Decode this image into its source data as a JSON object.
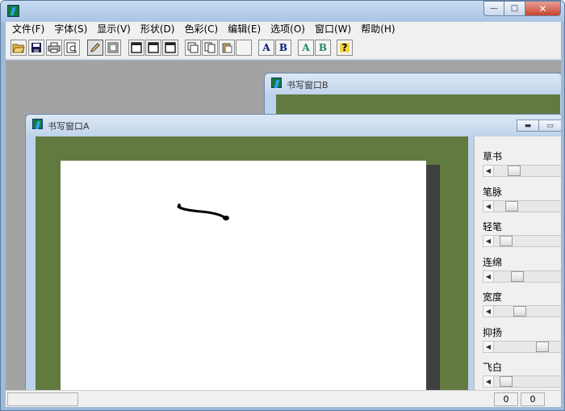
{
  "menu": [
    "文件(F)",
    "字体(S)",
    "显示(V)",
    "形状(D)",
    "色彩(C)",
    "编辑(E)",
    "选项(O)",
    "窗口(W)",
    "帮助(H)"
  ],
  "toolbar": {
    "font_a_label": "A",
    "font_b_label": "B",
    "color_a_label": "A",
    "color_b_label": "B",
    "help_label": "?",
    "icons": [
      "open-folder-icon",
      "save-icon",
      "print-icon",
      "print-preview-icon",
      "pen-icon",
      "frame-icon",
      "window-layout-1-icon",
      "window-layout-2-icon",
      "window-layout-3-icon",
      "cut-icon",
      "copy-icon",
      "paste-icon",
      "blank-icon",
      "font-a-icon",
      "font-b-icon",
      "color-a-icon",
      "color-b-icon",
      "help-icon"
    ]
  },
  "window_b": {
    "title": "书写窗口B"
  },
  "window_a": {
    "title": "书写窗口A"
  },
  "sliders": [
    {
      "label": "草书",
      "value": 0.25
    },
    {
      "label": "笔脉",
      "value": 0.2
    },
    {
      "label": "轻笔",
      "value": 0.1
    },
    {
      "label": "连绵",
      "value": 0.3
    },
    {
      "label": "宽度",
      "value": 0.35
    },
    {
      "label": "抑扬",
      "value": 0.75
    },
    {
      "label": "飞白",
      "value": 0.1
    }
  ],
  "status": {
    "x": "0",
    "y": "0"
  },
  "colors": {
    "canvas_green": "#627a40",
    "mdi_gray": "#a3a3a3",
    "ink": "#000000"
  }
}
